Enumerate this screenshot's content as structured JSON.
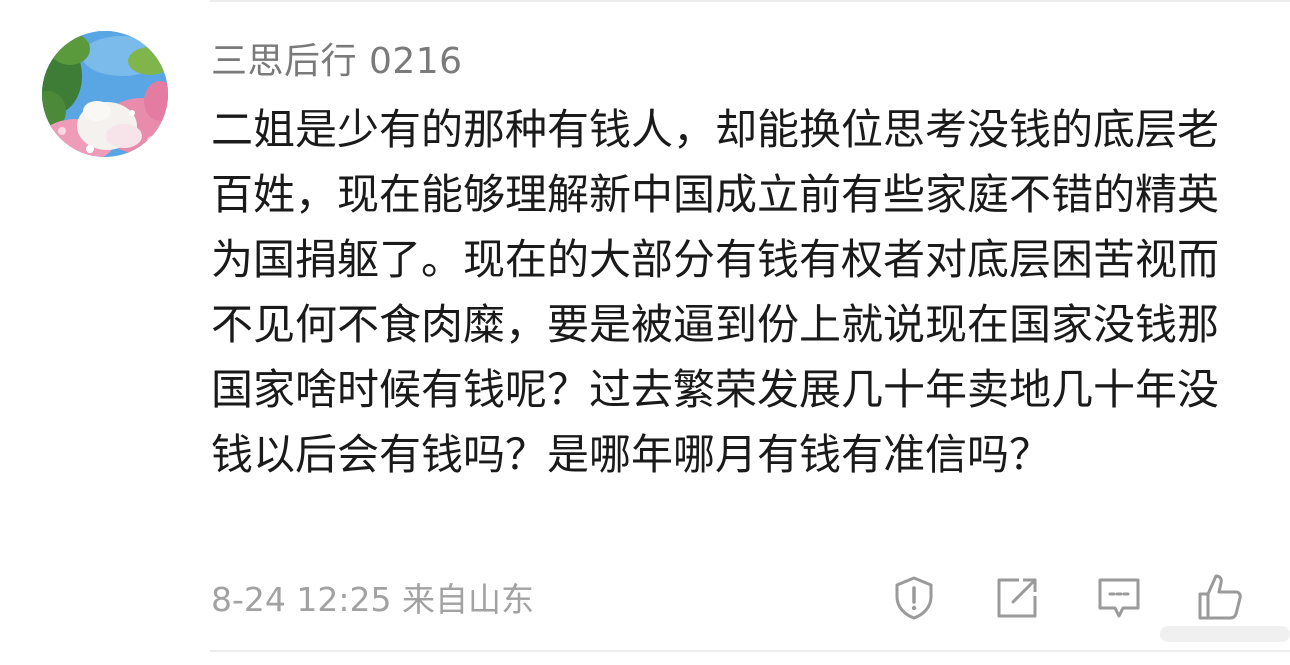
{
  "comment": {
    "username": "三思后行 0216",
    "text": "二姐是少有的那种有钱人，却能换位思考没钱的底层老百姓，现在能够理解新中国成立前有些家庭不错的精英为国捐躯了。现在的大部分有钱有权者对底层困苦视而不见何不食肉糜，要是被逼到份上就说现在国家没钱那国家啥时候有钱呢？过去繁荣发展几十年卖地几十年没钱以后会有钱吗？是哪年哪月有钱有准信吗？",
    "timestamp": "8-24 12:25",
    "location": "来自山东"
  },
  "actions": {
    "report_icon": "warning-shield-icon",
    "share_icon": "share-icon",
    "reply_icon": "comment-icon",
    "like_icon": "thumbs-up-icon"
  },
  "colors": {
    "username": "#7a7a7a",
    "body_text": "#1a1a1a",
    "meta_text": "#a2a2a2",
    "icon": "#9a9a9a",
    "divider": "#ececec"
  }
}
